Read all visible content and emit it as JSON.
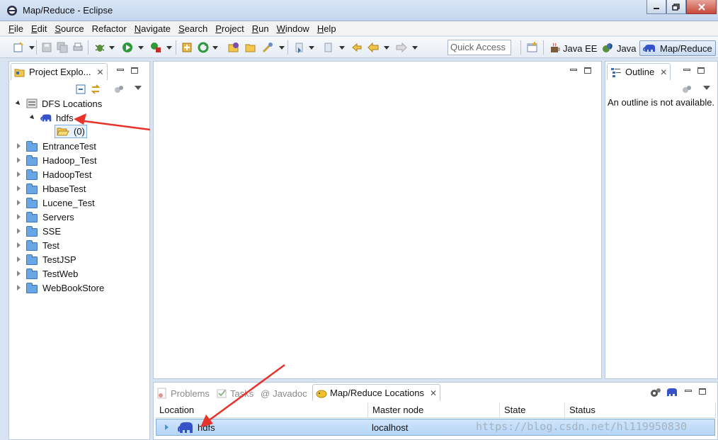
{
  "window": {
    "title": "Map/Reduce - Eclipse"
  },
  "menu": [
    "File",
    "Edit",
    "Source",
    "Refactor",
    "Navigate",
    "Search",
    "Project",
    "Run",
    "Window",
    "Help"
  ],
  "menu_underline": [
    "F",
    "E",
    "S",
    "",
    "N",
    "S",
    "P",
    "R",
    "W",
    "H"
  ],
  "quick_access": {
    "placeholder": "Quick Access"
  },
  "perspectives": [
    {
      "label": "Java EE",
      "icon": "java-ee-icon"
    },
    {
      "label": "Java",
      "icon": "java-icon"
    },
    {
      "label": "Map/Reduce",
      "icon": "elephant-icon",
      "active": true
    }
  ],
  "project_explorer": {
    "tab_label": "Project Explo...",
    "dfs_root": "DFS Locations",
    "hdfs_node": "hdfs",
    "hdfs_child": "(0)",
    "projects": [
      "EntranceTest",
      "Hadoop_Test",
      "HadoopTest",
      "HbaseTest",
      "Lucene_Test",
      "Servers",
      "SSE",
      "Test",
      "TestJSP",
      "TestWeb",
      "WebBookStore"
    ]
  },
  "outline": {
    "tab_label": "Outline",
    "message": "An outline is not available."
  },
  "bottom_panel": {
    "tabs": [
      "Problems",
      "Tasks",
      "Javadoc",
      "Map/Reduce Locations"
    ],
    "columns": [
      "Location",
      "Master node",
      "State",
      "Status"
    ],
    "rows": [
      {
        "location": "hdfs",
        "master_node": "localhost",
        "state": "",
        "status": ""
      }
    ]
  },
  "watermark": "https://blog.csdn.net/hl119950830",
  "colors": {
    "arrow": "#e8322a",
    "selection": "#b6d6f6",
    "accent": "#3f76b6"
  }
}
